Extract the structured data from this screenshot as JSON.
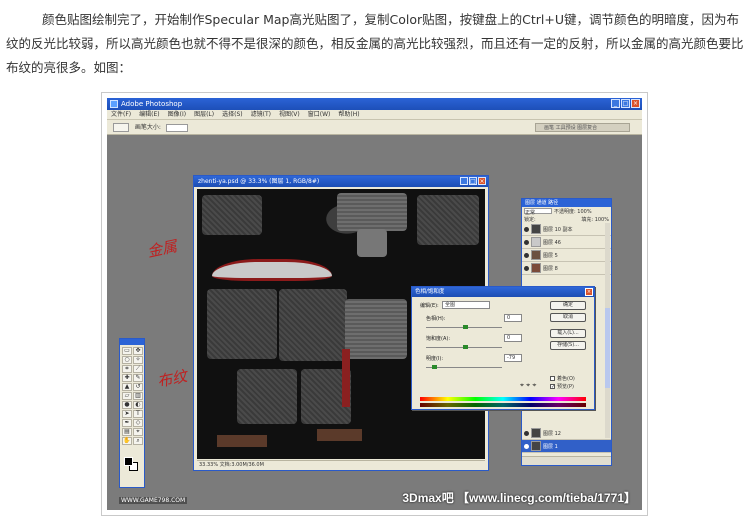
{
  "article": {
    "paragraph": "颜色贴图绘制完了，开始制作Specular Map高光贴图了，复制Color贴图，按键盘上的Ctrl+U键，调节颜色的明暗度，因为布纹的反光比较弱，所以高光颜色也就不得不是很深的颜色，相反金属的高光比较强烈，而且还有一定的反射，所以金属的高光颜色要比布纹的亮很多。如图："
  },
  "photoshop": {
    "title": "Adobe Photoshop",
    "menu": [
      "文件(F)",
      "编辑(E)",
      "图像(I)",
      "图层(L)",
      "选择(S)",
      "滤镜(T)",
      "视图(V)",
      "窗口(W)",
      "帮助(H)"
    ],
    "options_label": "画笔大小:",
    "palette_well": "画笔  工具预设  图层复合",
    "document": {
      "title": "zhenti-ya.psd @ 33.3% (图层 1, RGB/8#)",
      "status": "33.33%   文档:3.00M/36.0M"
    },
    "annotations": {
      "metal": "金属",
      "cloth": "布纹"
    },
    "layers": {
      "tabs": "图层  通道  路径",
      "blend_mode": "正常",
      "opacity_label": "不透明度: 100%",
      "lock_label": "锁定:",
      "fill_label": "填充: 100%",
      "items": [
        "图层 10 副本",
        "图层 46",
        "图层 5",
        "图层 8",
        "图层 12",
        "图层 1"
      ]
    },
    "hue_sat": {
      "title": "色相/饱和度",
      "edit_label": "编辑(E):",
      "edit_value": "全图",
      "hue_label": "色相(H):",
      "hue_value": "0",
      "sat_label": "饱和度(A):",
      "sat_value": "0",
      "light_label": "明度(I):",
      "light_value": "-79",
      "ok": "确定",
      "cancel": "取消",
      "load": "载入(L)...",
      "save": "存储(S)...",
      "colorize": "着色(O)",
      "preview": "预览(P)"
    },
    "watermark_left": "WWW.GAME798.COM",
    "watermark_right": "3Dmax吧 【www.linecg.com/tieba/1771】"
  }
}
